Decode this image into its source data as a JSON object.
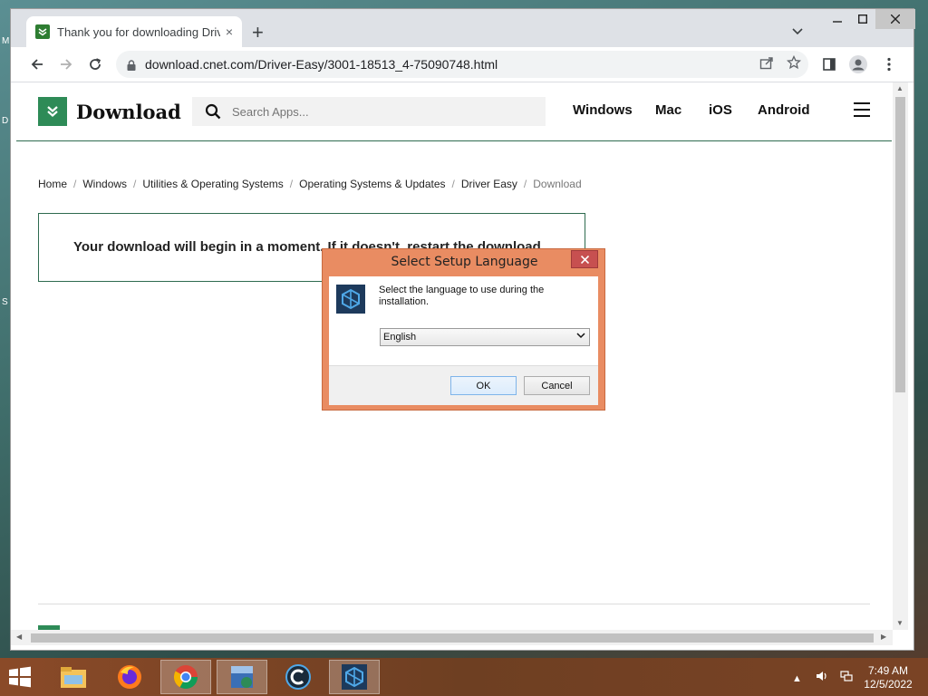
{
  "desktop": {
    "icon_letters": [
      "M",
      "D",
      "S"
    ]
  },
  "browser": {
    "tab_title": "Thank you for downloading Driver Easy",
    "tab_close": "×",
    "new_tab": "+",
    "tab_search": "⌄",
    "window_controls": {
      "minimize": "—",
      "maximize": "☐",
      "close": "✕"
    },
    "url": "download.cnet.com/Driver-Easy/3001-18513_4-75090748.html"
  },
  "site": {
    "logo_text": "Download",
    "search_placeholder": "Search Apps...",
    "nav": [
      "Windows",
      "Mac",
      "iOS",
      "Android"
    ],
    "breadcrumbs": [
      "Home",
      "Windows",
      "Utilities & Operating Systems",
      "Operating Systems & Updates",
      "Driver Easy",
      "Download"
    ],
    "breadcrumb_separator": "/",
    "download_message": "Your download will begin in a moment. If it doesn't, restart the download."
  },
  "dialog": {
    "title": "Select Setup Language",
    "close": "✕",
    "message": "Select the language to use during the installation.",
    "language_selected": "English",
    "ok_label": "OK",
    "cancel_label": "Cancel"
  },
  "taskbar": {
    "time": "7:49 AM",
    "date": "12/5/2022"
  }
}
